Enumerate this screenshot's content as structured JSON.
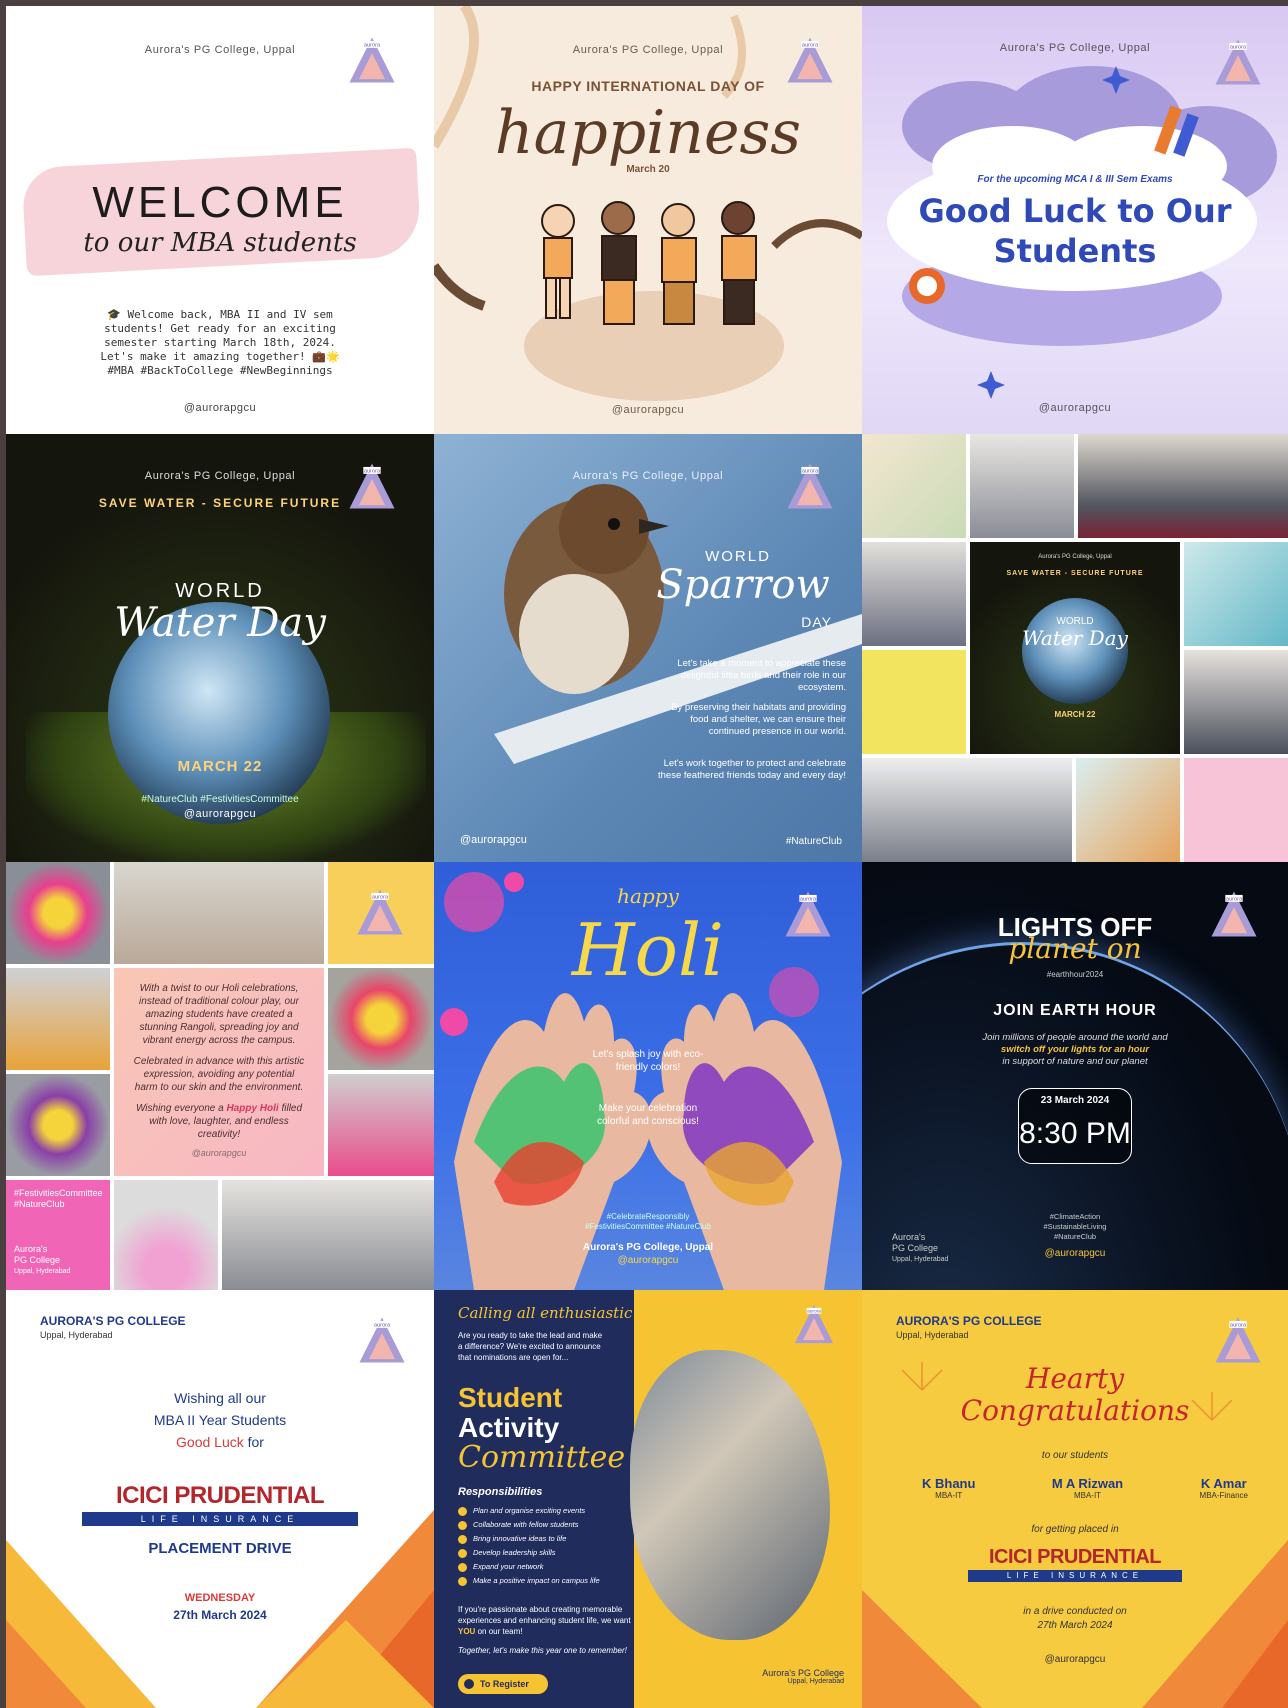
{
  "colors": {
    "lilac": "#a99bd6",
    "tri_pink": "#f2b6ae",
    "navy": "#1f2c5c",
    "yellow": "#f6cb3f"
  },
  "welcome": {
    "college": "Aurora's PG College, Uppal",
    "title": "WELCOME",
    "script": "to our MBA students",
    "body": "🎓 Welcome back, MBA II and IV sem students! Get ready for an exciting semester starting March 18th, 2024. Let's make it amazing together! 💼🌟 #MBA #BackToCollege #NewBeginnings",
    "handle": "@aurorapgcu"
  },
  "happiness": {
    "college": "Aurora's PG College, Uppal",
    "heading": "HAPPY INTERNATIONAL DAY OF",
    "script": "happiness",
    "date": "March 20",
    "handle": "@aurorapgcu"
  },
  "goodluck": {
    "college": "Aurora's PG College, Uppal",
    "sub": "For the upcoming MCA I & III Sem Exams",
    "title1": "Good Luck to Our",
    "title2": "Students",
    "handle": "@aurorapgcu"
  },
  "water": {
    "college": "Aurora's PG College, Uppal",
    "arc": "SAVE WATER - SECURE FUTURE",
    "word": "WORLD",
    "script": "Water Day",
    "date": "MARCH 22",
    "tags": "#NatureClub #FestivitiesCommittee",
    "handle": "@aurorapgcu"
  },
  "sparrow": {
    "college": "Aurora's PG College, Uppal",
    "world": "WORLD",
    "script": "Sparrow",
    "day": "DAY",
    "p1": "Let's take a moment to appreciate these delightful little birds and their role in our ecosystem.",
    "p2": "By preserving their habitats and providing food and shelter, we can ensure their continued presence in our world.",
    "p3": "Let's work together to protect and celebrate these feathered friends today and every day!",
    "handle": "@aurorapgcu",
    "tag": "#NatureClub"
  },
  "collage": {
    "mini_college": "Aurora's PG College, Uppal",
    "mini_arc": "SAVE WATER - SECURE FUTURE",
    "mini_word": "WORLD",
    "mini_script": "Water Day",
    "mini_date": "MARCH 22"
  },
  "holi_rangoli": {
    "p1": "With a twist to our Holi celebrations, instead of traditional colour play, our amazing students have created a stunning Rangoli, spreading joy and vibrant energy across the campus.",
    "p2": "Celebrated in advance with this artistic expression, avoiding any potential harm to our skin and the environment.",
    "p3a": "Wishing everyone a ",
    "p3b": "Happy Holi",
    "p3c": " filled with love, laughter, and endless creativity!",
    "handle": "@aurorapgcu",
    "tags1": "#FestivitiesCommittee",
    "tags2": "#NatureClub",
    "college1": "Aurora's",
    "college2": "PG College",
    "college3": "Uppal, Hyderabad"
  },
  "holi": {
    "happy": "happy",
    "script": "Holi",
    "t1": "Let's splash joy with eco-friendly colors!",
    "t2": "Make your celebration colorful and conscious!",
    "tags1": "#CelebrateResponsibly",
    "tags2": "#FestivitiesCommittee #NatureClub",
    "college": "Aurora's PG College, Uppal",
    "handle": "@aurorapgcu"
  },
  "earth": {
    "t1": "LIGHTS OFF",
    "t2": "planet on",
    "tag": "#earthhour2024",
    "join": "JOIN EARTH HOUR",
    "p1": "Join millions of people around the world and",
    "p2": "switch off your lights for an hour",
    "p3": "in support of nature and our planet",
    "date": "23 March 2024",
    "time": "8:30 PM",
    "college1": "Aurora's",
    "college2": "PG College",
    "college3": "Uppal, Hyderabad",
    "tags": "#ClimateAction #SustainableLiving #NatureClub",
    "handle": "@aurorapgcu"
  },
  "placement": {
    "college": "AURORA'S PG COLLEGE",
    "loc": "Uppal, Hyderabad",
    "w1": "Wishing all our",
    "w2": "MBA II Year Students",
    "w3": "Good Luck",
    "w4": " for",
    "brand": "ICICI PRUDENTIAL",
    "brand_sub": "LIFE INSURANCE",
    "drive": "PLACEMENT DRIVE",
    "day": "WEDNESDAY",
    "date": "27th March 2024"
  },
  "committee": {
    "calling": "Calling all enthusiastic students!",
    "intro": "Are you ready to take the lead and make a difference? We're excited to announce that nominations are open for...",
    "t1": "Student",
    "t2": "Activity",
    "t3": "Committee",
    "resp": "Responsibilities",
    "items": [
      "Plan and organise exciting events",
      "Collaborate with fellow students",
      "Bring innovative ideas to life",
      "Develop leadership skills",
      "Expand your network",
      "Make a positive impact on campus life"
    ],
    "p1": "If you're passionate about creating memorable experiences and enhancing student life, we want ",
    "you": "YOU",
    "p1b": " on our team!",
    "p2": "Together, let's make this year one to remember!",
    "btn": "To Register",
    "college": "Aurora's PG College",
    "loc": "Uppal, Hyderabad"
  },
  "congrats": {
    "college": "AURORA'S PG COLLEGE",
    "loc": "Uppal, Hyderabad",
    "h1": "Hearty",
    "h2": "Congratulations",
    "to": "to our students",
    "students": [
      {
        "name": "K Bhanu",
        "dept": "MBA-IT"
      },
      {
        "name": "M A Rizwan",
        "dept": "MBA-IT"
      },
      {
        "name": "K Amar",
        "dept": "MBA-Finance"
      }
    ],
    "placed": "for getting placed in",
    "brand": "ICICI PRUDENTIAL",
    "brand_sub": "LIFE INSURANCE",
    "drive1": "in a drive conducted on",
    "drive2": "27th March 2024",
    "handle": "@aurorapgcu"
  }
}
